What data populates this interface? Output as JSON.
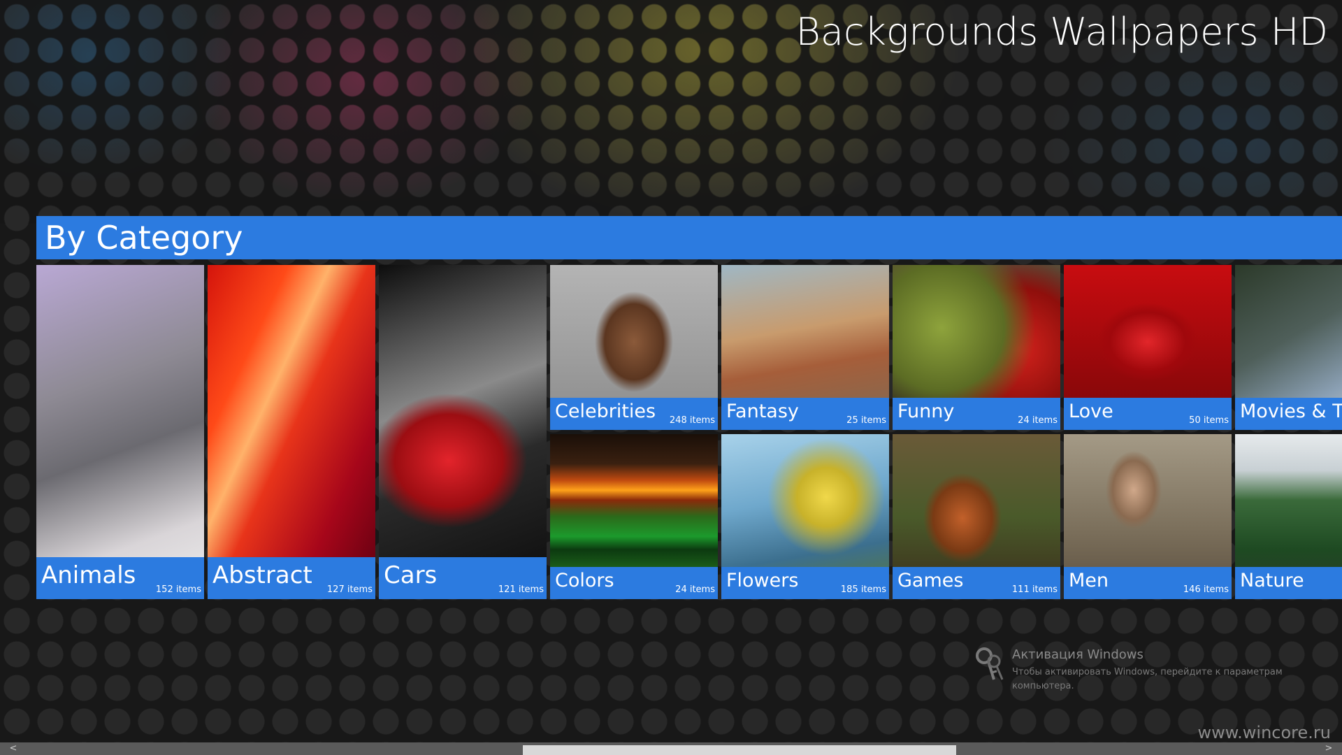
{
  "app": {
    "title": "Backgrounds Wallpapers HD"
  },
  "section": {
    "title": "By Category"
  },
  "categories": [
    {
      "name": "Animals",
      "count": "152 items",
      "image": "cat-photo"
    },
    {
      "name": "Abstract",
      "count": "127 items",
      "image": "red-abstract-photo"
    },
    {
      "name": "Cars",
      "count": "121 items",
      "image": "red-car-photo"
    },
    {
      "name": "Celebrities",
      "count": "248 items",
      "image": "woman-portrait-photo"
    },
    {
      "name": "Colors",
      "count": "24 items",
      "image": "color-stripes-photo"
    },
    {
      "name": "Fantasy",
      "count": "25 items",
      "image": "castle-rock-photo"
    },
    {
      "name": "Flowers",
      "count": "185 items",
      "image": "flowers-photo"
    },
    {
      "name": "Funny",
      "count": "24 items",
      "image": "cartoon-fruits-photo"
    },
    {
      "name": "Games",
      "count": "111 items",
      "image": "dwarf-warrior-photo"
    },
    {
      "name": "Love",
      "count": "50 items",
      "image": "heart-candle-photo"
    },
    {
      "name": "Men",
      "count": "146 items",
      "image": "man-portrait-photo"
    },
    {
      "name": "Movies & TV",
      "count": "",
      "image": "movie-scene-photo"
    },
    {
      "name": "Nature",
      "count": "",
      "image": "forest-lake-photo"
    }
  ],
  "activation": {
    "title": "Активация Windows",
    "text": "Чтобы активировать Windows, перейдите к параметрам компьютера.",
    "icon": "key-icon"
  },
  "watermark": "www.wincore.ru",
  "scrollbar": {
    "left_arrow": "<",
    "right_arrow": ">"
  },
  "colors": {
    "accent": "#2c7be0",
    "background": "#181818"
  }
}
